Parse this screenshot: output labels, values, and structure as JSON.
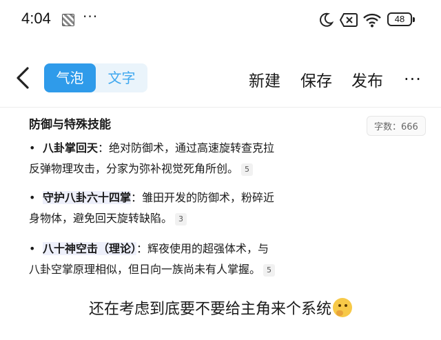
{
  "status_bar": {
    "time": "4:04",
    "dots": "···",
    "battery": "48",
    "icons": [
      "app-icon",
      "moon-icon",
      "screen-x-icon",
      "wifi-icon",
      "battery-icon"
    ]
  },
  "toolbar": {
    "back_icon": "chevron-left-icon",
    "tabs": [
      {
        "label": "气泡",
        "selected": true
      },
      {
        "label": "文字",
        "selected": false
      }
    ],
    "new_label": "新建",
    "save_label": "保存",
    "publish_label": "发布",
    "more_label": "···",
    "accent_color": "#2f9bea"
  },
  "content": {
    "heading": "防御与特殊技能",
    "word_count": "字数：666",
    "items": [
      {
        "term": "八卦掌回天",
        "line1": "：绝对防御术，通过高速旋转查克拉",
        "line2": "反弹物理攻击，分家为弥补视觉死角所创。",
        "ref": "5"
      },
      {
        "term": "守护八卦六十四掌",
        "line1": "：雏田开发的防御术，粉碎近",
        "line2": "身物体，避免回天旋转缺陷。",
        "ref": "3"
      },
      {
        "term": "八十神空击（理论）",
        "line1": "：辉夜使用的超强体术，与",
        "line2": "八卦空掌原理相似，但日向一族尚未有人掌握。",
        "ref": "5"
      }
    ]
  },
  "caption": {
    "text": "还在考虑到底要不要给主角来个系统",
    "emoji": "thinking-face-emoji"
  }
}
